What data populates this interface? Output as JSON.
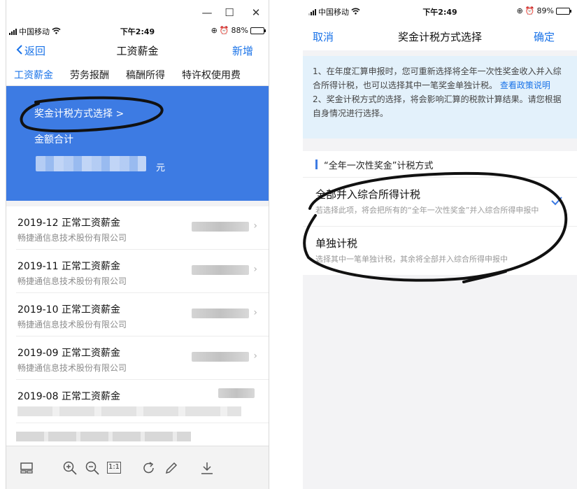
{
  "left": {
    "window_controls": {
      "minimize": "—",
      "maximize": "☐",
      "close": "✕"
    },
    "status": {
      "carrier": "中国移动",
      "time": "下午2:49",
      "battery": "88%"
    },
    "nav": {
      "back": "返回",
      "title": "工资薪金",
      "action": "新增"
    },
    "tabs": [
      {
        "label": "工资薪金",
        "active": true
      },
      {
        "label": "劳务报酬",
        "active": false
      },
      {
        "label": "稿酬所得",
        "active": false
      },
      {
        "label": "特许权使用费",
        "active": false
      }
    ],
    "hero": {
      "method_link": "奖金计税方式选择 >",
      "total_label": "金额合计",
      "unit": "元"
    },
    "records": [
      {
        "title": "2019-12 正常工资薪金",
        "company": "畅捷通信息技术股份有限公司"
      },
      {
        "title": "2019-11 正常工资薪金",
        "company": "畅捷通信息技术股份有限公司"
      },
      {
        "title": "2019-10 正常工资薪金",
        "company": "畅捷通信息技术股份有限公司"
      },
      {
        "title": "2019-09 正常工资薪金",
        "company": "畅捷通信息技术股份有限公司"
      },
      {
        "title": "2019-08 正常工资薪金",
        "company": ""
      }
    ],
    "toolbar_icons": [
      "thumbnail-icon",
      "zoom-in-icon",
      "zoom-out-icon",
      "actual-size-icon",
      "rotate-icon",
      "edit-icon",
      "download-icon"
    ],
    "toolbar_actual_size_label": "1:1"
  },
  "right": {
    "status": {
      "carrier": "中国移动",
      "time": "下午2:49",
      "battery": "89%"
    },
    "nav": {
      "cancel": "取消",
      "title": "奖金计税方式选择",
      "confirm": "确定"
    },
    "notice": {
      "line1": "1、在年度汇算申报时，您可重新选择将全年一次性奖金收入并入综合所得计税，也可以选择其中一笔奖金单独计税。",
      "link": "查看政策说明",
      "line2": "2、奖金计税方式的选择，将会影响汇算的税款计算结果。请您根据自身情况进行选择。"
    },
    "section_title": "“全年一次性奖金”计税方式",
    "options": [
      {
        "title": "全部并入综合所得计税",
        "desc": "若选择此项，将会把所有的“全年一次性奖金”并入综合所得申报中",
        "selected": true
      },
      {
        "title": "单独计税",
        "desc": "选择其中一笔单独计税，其余将全部并入综合所得申报中",
        "selected": false
      }
    ]
  },
  "colors": {
    "accent": "#1a73e8",
    "hero_blue": "#3d7be3",
    "notice_bg": "#e3f1fb",
    "page_gray": "#f3f3f5"
  }
}
